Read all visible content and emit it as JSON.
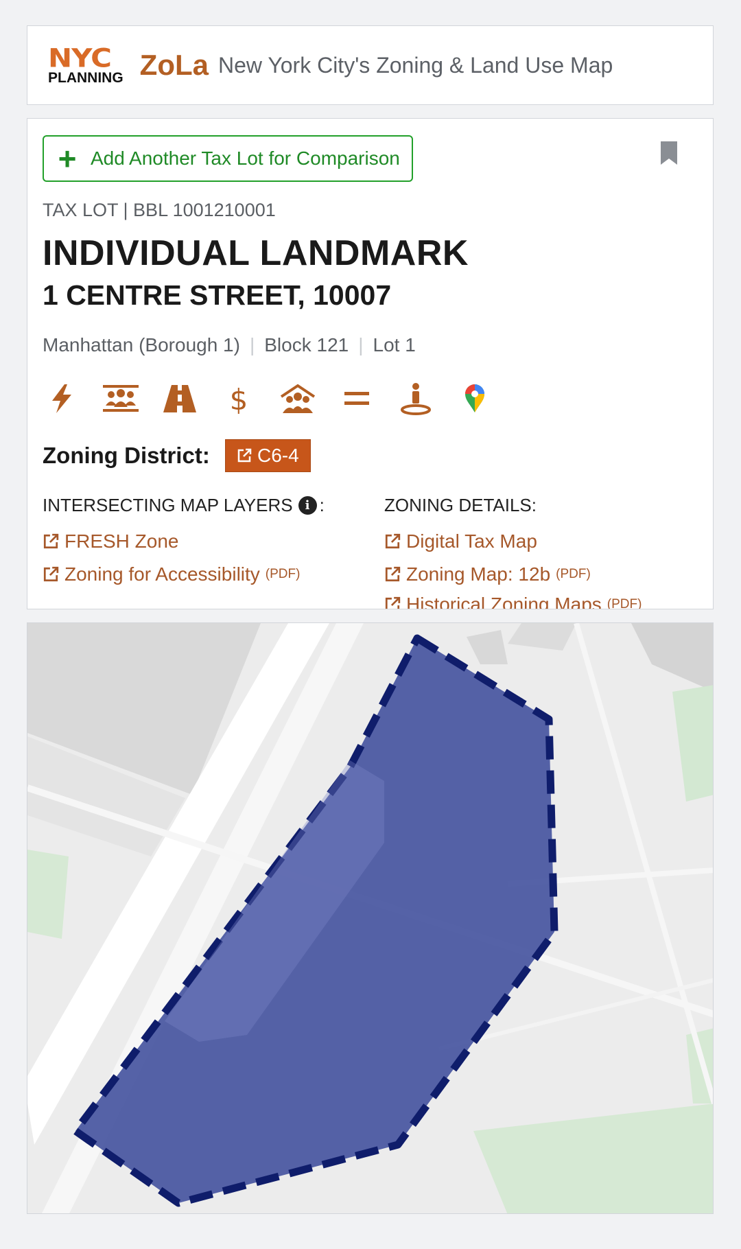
{
  "header": {
    "logo_nyc": "NYC",
    "logo_planning": "PLANNING",
    "app_name": "ZoLa",
    "subtitle": "New York City's Zoning & Land Use Map"
  },
  "card": {
    "add_button_label": "Add Another Tax Lot for Comparison",
    "taxlot_label": "TAX LOT | BBL 1001210001",
    "title": "INDIVIDUAL LANDMARK",
    "address": "1 CENTRE STREET, 10007",
    "borough": "Manhattan (Borough 1)",
    "block": "Block 121",
    "lot": "Lot 1",
    "icons": [
      "lightning-icon",
      "people-icon",
      "road-icon",
      "dollar-icon",
      "community-icon",
      "equals-icon",
      "person-pin-icon",
      "map-pin-icon"
    ],
    "zoning_district_label": "Zoning District:",
    "zoning_district_value": "C6-4",
    "intersecting_header": "INTERSECTING MAP LAYERS",
    "intersecting_header_suffix": ":",
    "zoning_details_header": "ZONING DETAILS:",
    "intersecting_links": [
      {
        "label": "FRESH Zone",
        "suffix": ""
      },
      {
        "label": "Zoning for Accessibility",
        "suffix": "(PDF)"
      }
    ],
    "zoning_links": [
      {
        "label": "Digital Tax Map",
        "suffix": ""
      },
      {
        "label": "Zoning Map: 12b",
        "suffix": "(PDF)"
      },
      {
        "label": "Historical Zoning Maps",
        "suffix": "(PDF)"
      }
    ]
  },
  "colors": {
    "accent": "#b35f23",
    "badge": "#c7561a",
    "add_button": "#22a02a",
    "lot_fill": "#3f4d9c",
    "lot_outline": "#0f1d6b"
  }
}
